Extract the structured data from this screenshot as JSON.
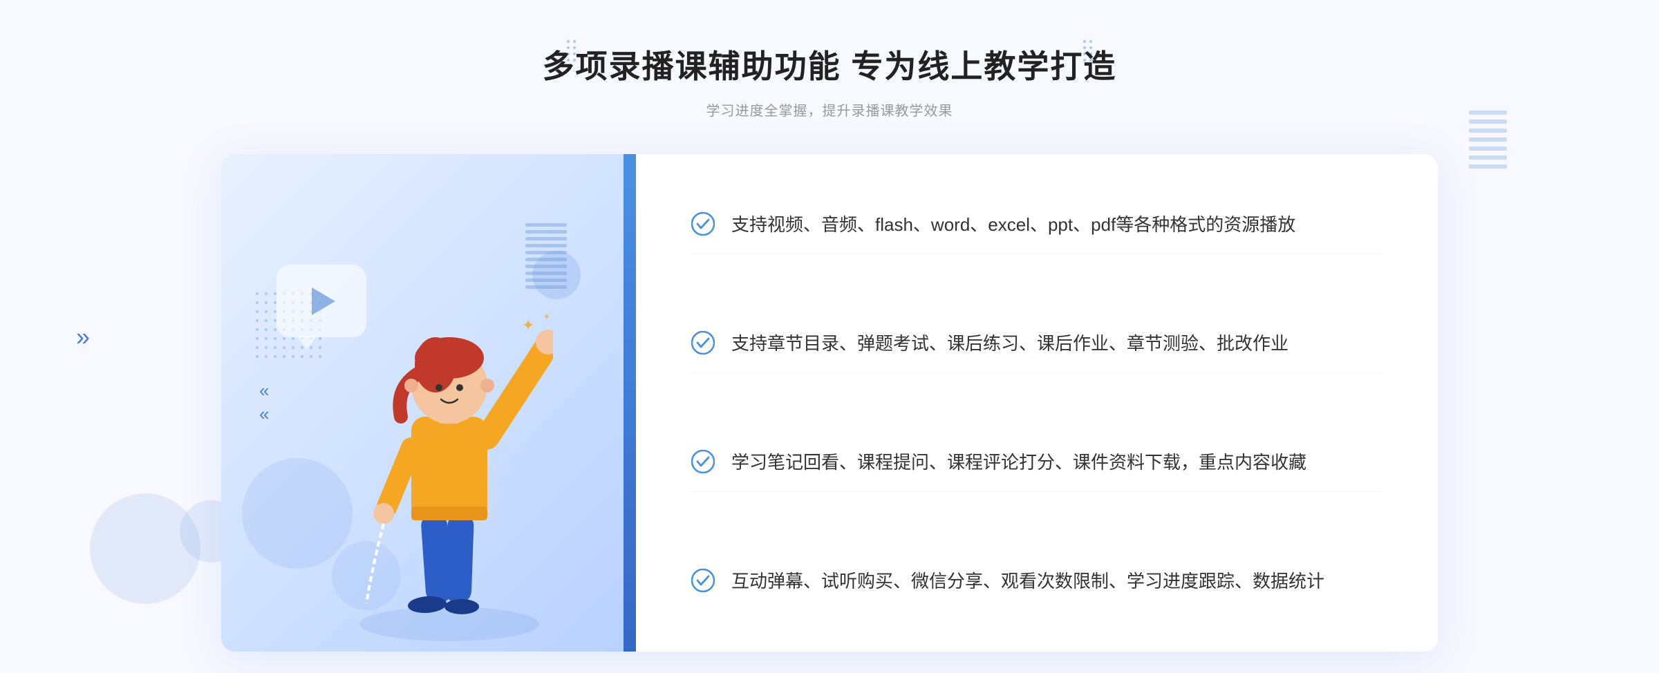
{
  "page": {
    "background": "#f8f9ff"
  },
  "header": {
    "main_title": "多项录播课辅助功能 专为线上教学打造",
    "sub_title": "学习进度全掌握，提升录播课教学效果"
  },
  "features": [
    {
      "id": 1,
      "text": "支持视频、音频、flash、word、excel、ppt、pdf等各种格式的资源播放"
    },
    {
      "id": 2,
      "text": "支持章节目录、弹题考试、课后练习、课后作业、章节测验、批改作业"
    },
    {
      "id": 3,
      "text": "学习笔记回看、课程提问、课程评论打分、课件资料下载，重点内容收藏"
    },
    {
      "id": 4,
      "text": "互动弹幕、试听购买、微信分享、观看次数限制、学习进度跟踪、数据统计"
    }
  ],
  "icons": {
    "check": "✓",
    "play": "▶",
    "chevron": "»"
  }
}
